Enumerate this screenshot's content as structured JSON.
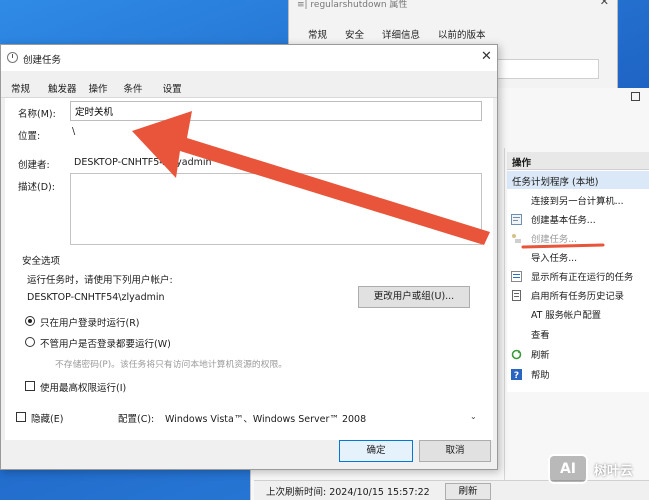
{
  "back_window": {
    "title": "≡| regularshutdown 属性",
    "close": "✕",
    "tabs": [
      "常规",
      "安全",
      "详细信息",
      "以前的版本"
    ]
  },
  "scheduler": {
    "actions_header": "操作",
    "section": "任务计划程序 (本地)",
    "actions": [
      {
        "label": "连接到另一台计算机...",
        "icon": "computer-icon",
        "disabled": false
      },
      {
        "label": "创建基本任务...",
        "icon": "wizard-icon",
        "disabled": false
      },
      {
        "label": "创建任务...",
        "icon": "task-icon",
        "disabled": true
      },
      {
        "label": "导入任务...",
        "icon": "",
        "disabled": false
      },
      {
        "label": "显示所有正在运行的任务",
        "icon": "list-icon",
        "disabled": false
      },
      {
        "label": "启用所有任务历史记录",
        "icon": "history-icon",
        "disabled": false
      },
      {
        "label": "AT 服务帐户配置",
        "icon": "",
        "disabled": false
      },
      {
        "label": "查看",
        "icon": "",
        "disabled": false
      },
      {
        "label": "刷新",
        "icon": "refresh-icon",
        "disabled": false
      },
      {
        "label": "帮助",
        "icon": "help-icon",
        "disabled": false
      }
    ],
    "status_text": "上次刷新时间: 2024/10/15 15:57:22",
    "refresh_button": "刷新"
  },
  "dialog": {
    "title": "创建任务",
    "close": "✕",
    "tabs": [
      "常规",
      "触发器",
      "操作",
      "条件",
      "设置"
    ],
    "name_label": "名称(M):",
    "name_value": "定时关机",
    "location_label": "位置:",
    "location_value": "\\",
    "author_label": "创建者:",
    "author_value": "DESKTOP-CNHTF54\\zlyadmin",
    "description_label": "描述(D):",
    "security": {
      "group_label": "安全选项",
      "run_as_prompt": "运行任务时，请使用下列用户帐户:",
      "user": "DESKTOP-CNHTF54\\zlyadmin",
      "change_user_button": "更改用户或组(U)...",
      "radio_logged_on": "只在用户登录时运行(R)",
      "radio_always": "不管用户是否登录都要运行(W)",
      "no_store_password": "不存储密码(P)。该任务将只有访问本地计算机资源的权限。",
      "highest_privileges": "使用最高权限运行(I)"
    },
    "hidden_label": "隐藏(E)",
    "configure_label": "配置(C):",
    "configure_value": "Windows Vista™、Windows Server™ 2008",
    "ok_button": "确定",
    "cancel_button": "取消"
  },
  "watermark": {
    "logo": "AI",
    "text": "树叶云"
  },
  "colors": {
    "annotation_red": "#e8553a",
    "accent_blue": "#0078d7"
  }
}
